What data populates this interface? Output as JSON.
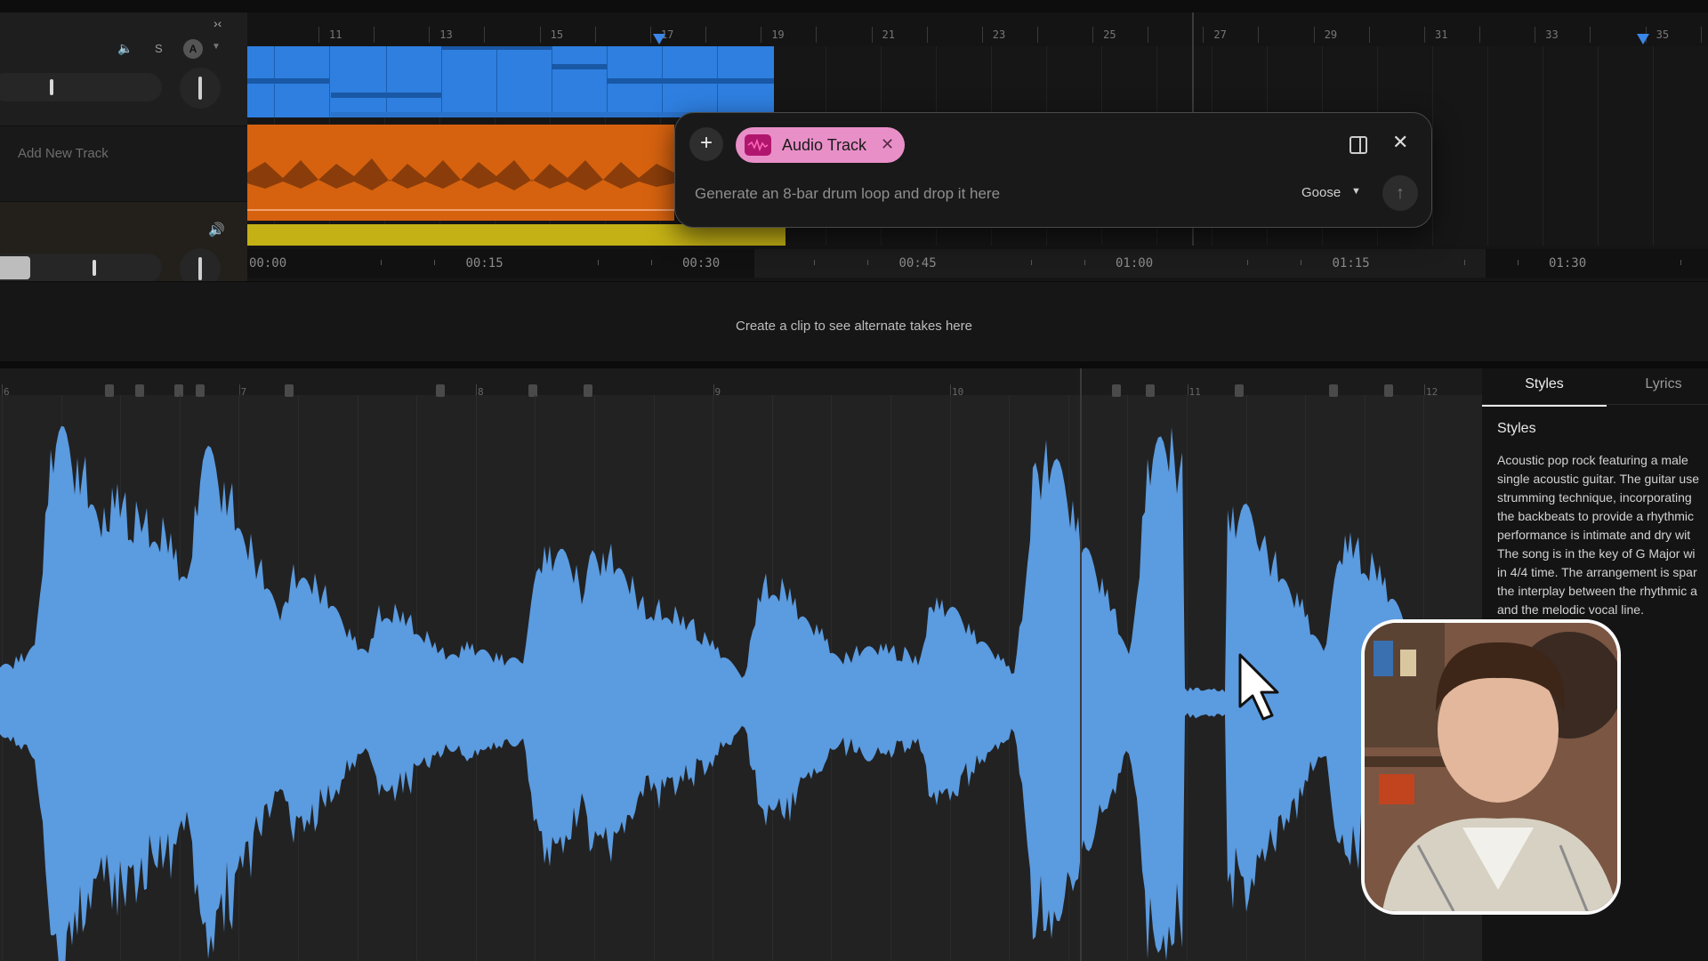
{
  "left_panel": {
    "solo_label": "S",
    "arm_label": "A",
    "add_track_label": "Add New Track"
  },
  "ruler_bars": [
    "11",
    "13",
    "15",
    "17",
    "19",
    "21",
    "23",
    "25",
    "27",
    "29",
    "31",
    "33",
    "35"
  ],
  "time_labels": [
    "00:00",
    "00:15",
    "00:30",
    "00:45",
    "01:00",
    "01:15",
    "01:30"
  ],
  "prompt": {
    "attachment_label": "Audio Track",
    "input_text": "Generate an 8-bar drum loop and drop it here",
    "model": "Goose"
  },
  "takes": {
    "empty_text": "Create a clip to see alternate takes here"
  },
  "editor_bars": [
    "6",
    "7",
    "8",
    "9",
    "10",
    "11",
    "12"
  ],
  "side_panel": {
    "tabs": [
      "Styles",
      "Lyrics"
    ],
    "heading": "Styles",
    "description_lines": [
      "Acoustic pop rock featuring a male",
      "single acoustic guitar. The guitar use",
      "strumming technique, incorporating",
      "the backbeats to provide a rhythmic",
      "performance is intimate and dry wit",
      "The song is in the key of G Major wi",
      "in 4/4 time. The arrangement is spar",
      "the interplay between the rhythmic a",
      "and the melodic vocal line."
    ]
  },
  "colors": {
    "clip_blue": "#2e7fe0",
    "clip_orange": "#d6620f",
    "clip_yellow": "#c4b115",
    "chip_pink": "#e98fc8",
    "waveform": "#5b9be0"
  }
}
